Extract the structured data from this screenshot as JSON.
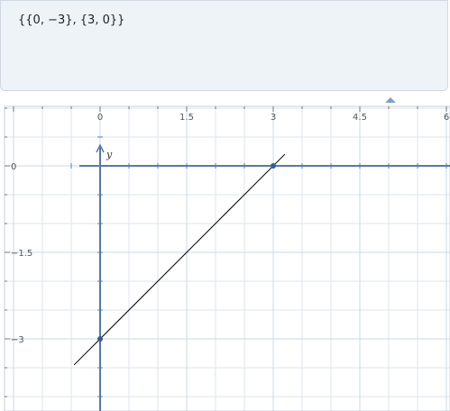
{
  "input": {
    "expression": "{{0, −3}, {3, 0}}"
  },
  "graph": {
    "x_ticks": [
      "0",
      "1.5",
      "3",
      "4.5",
      "6"
    ],
    "y_ticks": [
      "0",
      "−1.5",
      "−3"
    ],
    "y_axis_name": "y",
    "axis_color": "#5a78a8",
    "grid_color": "#dde5ee",
    "line_color": "#000000",
    "point_color": "#2f5d9a"
  },
  "chart_data": {
    "type": "line",
    "points": [
      {
        "x": 0,
        "y": -3
      },
      {
        "x": 3,
        "y": 0
      }
    ],
    "line": {
      "slope": 1,
      "intercept": -3
    },
    "xlim": [
      -1.75,
      6.05
    ],
    "ylim": [
      -4.25,
      1.05
    ],
    "grid": true
  }
}
